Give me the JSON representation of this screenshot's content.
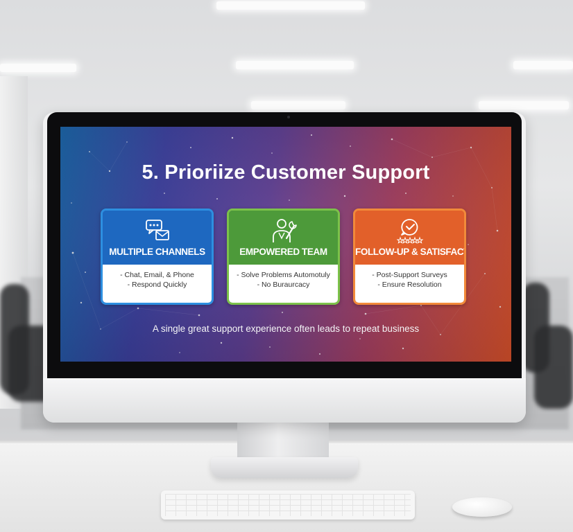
{
  "slide": {
    "title": "5. Prioriize Customer Support",
    "cards": [
      {
        "title": "MULTIPLE CHANNELS",
        "icon": "chat-email-icon",
        "lines": [
          "- Chat, Email, & Phone",
          "- Respond Quickly"
        ],
        "color": "#1e68c0"
      },
      {
        "title": "EMPOWERED TEAM",
        "icon": "person-wrench-icon",
        "lines": [
          "- Solve Problems Automotuly",
          "- No Buraurcacy"
        ],
        "color": "#4d9a3a"
      },
      {
        "title": "FOLLOW-UP & SATISFACTION",
        "icon": "checkmark-stars-icon",
        "lines": [
          "- Post-Support Surveys",
          "- Ensure Resolution"
        ],
        "color": "#e2602a"
      }
    ],
    "tagline": "A single great support experience often leads to repeat business"
  },
  "colors": {
    "gradient_start": "#1c6bb3",
    "gradient_mid": "#5a3a8e",
    "gradient_end": "#e0542c"
  }
}
